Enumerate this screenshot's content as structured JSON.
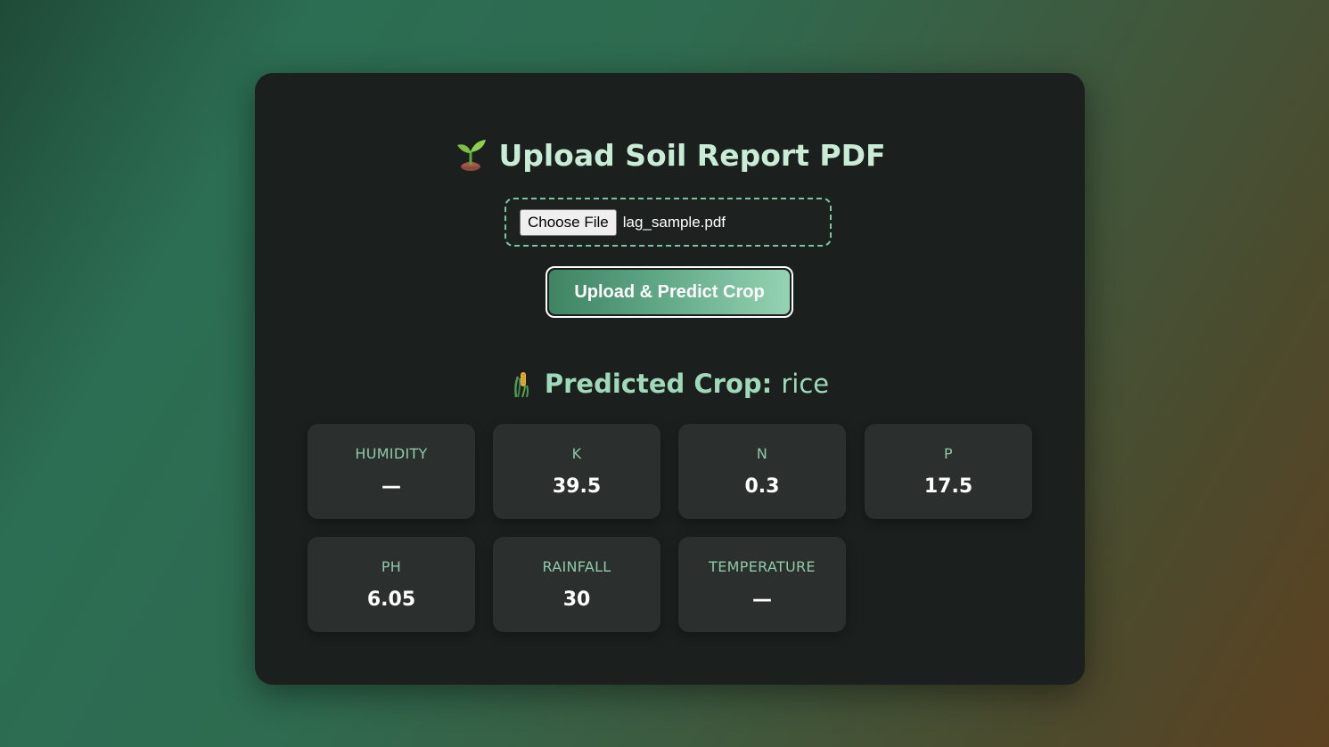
{
  "title": {
    "icon": "seedling-icon",
    "text": "Upload Soil Report PDF"
  },
  "file_input": {
    "button_label": "Choose File",
    "file_name": "lag_sample.pdf"
  },
  "submit_button": {
    "label": "Upload & Predict Crop"
  },
  "prediction": {
    "icon": "corn-stalk-icon",
    "label": "Predicted Crop:",
    "value": "rice"
  },
  "metrics": [
    {
      "label": "HUMIDITY",
      "value": "—"
    },
    {
      "label": "K",
      "value": "39.5"
    },
    {
      "label": "N",
      "value": "0.3"
    },
    {
      "label": "P",
      "value": "17.5"
    },
    {
      "label": "PH",
      "value": "6.05"
    },
    {
      "label": "RAINFALL",
      "value": "30"
    },
    {
      "label": "TEMPERATURE",
      "value": "—"
    }
  ],
  "colors": {
    "accent": "#7cc3a0",
    "title_text": "#c8ecd6",
    "card_background": "#1b201e",
    "tile_background": "#2b302e"
  }
}
